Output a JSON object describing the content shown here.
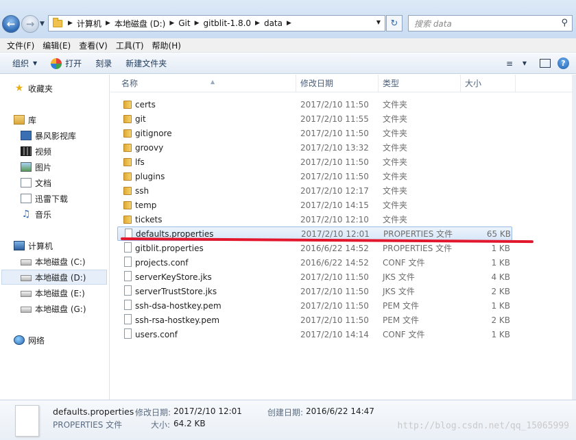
{
  "address_bar": {
    "crumbs": [
      "计算机",
      "本地磁盘 (D:)",
      "Git",
      "gitblit-1.8.0",
      "data"
    ],
    "search_placeholder": "搜索 data"
  },
  "menubar": [
    "文件(F)",
    "编辑(E)",
    "查看(V)",
    "工具(T)",
    "帮助(H)"
  ],
  "toolbar": {
    "organize": "组织",
    "open": "打开",
    "burn": "刻录",
    "new_folder": "新建文件夹"
  },
  "nav": {
    "favorites": "收藏夹",
    "libraries": "库",
    "lib_items": [
      "暴风影视库",
      "视频",
      "图片",
      "文档",
      "迅雷下载",
      "音乐"
    ],
    "computer": "计算机",
    "drives": [
      "本地磁盘 (C:)",
      "本地磁盘 (D:)",
      "本地磁盘 (E:)",
      "本地磁盘 (G:)"
    ],
    "network": "网络"
  },
  "columns": {
    "name": "名称",
    "date": "修改日期",
    "type": "类型",
    "size": "大小"
  },
  "files": [
    {
      "name": "certs",
      "date": "2017/2/10 11:50",
      "type": "文件夹",
      "size": "",
      "kind": "folder"
    },
    {
      "name": "git",
      "date": "2017/2/10 11:55",
      "type": "文件夹",
      "size": "",
      "kind": "folder"
    },
    {
      "name": "gitignore",
      "date": "2017/2/10 11:50",
      "type": "文件夹",
      "size": "",
      "kind": "folder"
    },
    {
      "name": "groovy",
      "date": "2017/2/10 13:32",
      "type": "文件夹",
      "size": "",
      "kind": "folder"
    },
    {
      "name": "lfs",
      "date": "2017/2/10 11:50",
      "type": "文件夹",
      "size": "",
      "kind": "folder"
    },
    {
      "name": "plugins",
      "date": "2017/2/10 11:50",
      "type": "文件夹",
      "size": "",
      "kind": "folder"
    },
    {
      "name": "ssh",
      "date": "2017/2/10 12:17",
      "type": "文件夹",
      "size": "",
      "kind": "folder"
    },
    {
      "name": "temp",
      "date": "2017/2/10 14:15",
      "type": "文件夹",
      "size": "",
      "kind": "folder"
    },
    {
      "name": "tickets",
      "date": "2017/2/10 12:10",
      "type": "文件夹",
      "size": "",
      "kind": "folder"
    },
    {
      "name": "defaults.properties",
      "date": "2017/2/10 12:01",
      "type": "PROPERTIES 文件",
      "size": "65 KB",
      "kind": "file"
    },
    {
      "name": "gitblit.properties",
      "date": "2016/6/22 14:52",
      "type": "PROPERTIES 文件",
      "size": "1 KB",
      "kind": "file"
    },
    {
      "name": "projects.conf",
      "date": "2016/6/22 14:52",
      "type": "CONF 文件",
      "size": "1 KB",
      "kind": "file"
    },
    {
      "name": "serverKeyStore.jks",
      "date": "2017/2/10 11:50",
      "type": "JKS 文件",
      "size": "4 KB",
      "kind": "file"
    },
    {
      "name": "serverTrustStore.jks",
      "date": "2017/2/10 11:50",
      "type": "JKS 文件",
      "size": "2 KB",
      "kind": "file"
    },
    {
      "name": "ssh-dsa-hostkey.pem",
      "date": "2017/2/10 11:50",
      "type": "PEM 文件",
      "size": "1 KB",
      "kind": "file"
    },
    {
      "name": "ssh-rsa-hostkey.pem",
      "date": "2017/2/10 11:50",
      "type": "PEM 文件",
      "size": "2 KB",
      "kind": "file"
    },
    {
      "name": "users.conf",
      "date": "2017/2/10 14:14",
      "type": "CONF 文件",
      "size": "1 KB",
      "kind": "file"
    }
  ],
  "selected_file": "defaults.properties",
  "details": {
    "filename": "defaults.properties",
    "type": "PROPERTIES 文件",
    "modified_label": "修改日期:",
    "modified": "2017/2/10 12:01",
    "created_label": "创建日期:",
    "created": "2016/6/22 14:47",
    "size_label": "大小:",
    "size": "64.2 KB"
  },
  "watermark": "http://blog.csdn.net/qq_15065999"
}
